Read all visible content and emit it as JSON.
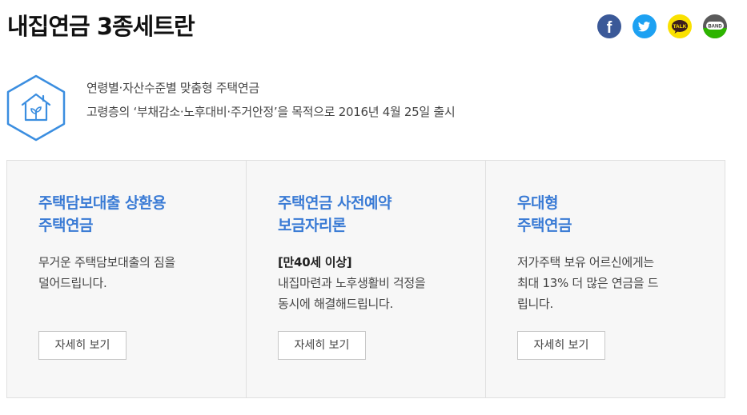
{
  "page": {
    "title": "내집연금 3종세트란"
  },
  "share": {
    "items": [
      {
        "name": "facebook-icon",
        "glyph": "f",
        "color": "#3b5998"
      },
      {
        "name": "twitter-icon",
        "color": "#1da1f2"
      },
      {
        "name": "kakaotalk-icon",
        "glyph": "TALK",
        "color": "#fae100"
      },
      {
        "name": "band-icon",
        "glyph": "BAND",
        "color": "#5a5a5a"
      }
    ]
  },
  "intro": {
    "icon": "house-plant-icon",
    "line1": "연령별·자산수준별 맞춤형 주택연금",
    "line2": "고령층의 ‘부채감소·노후대비·주거안정’을 목적으로 2016년 4월 25일 출시"
  },
  "cards": [
    {
      "title_line1": "주택담보대출 상환용",
      "title_line2": "주택연금",
      "highlight": "",
      "desc_line1": "무거운 주택담보대출의 짐을",
      "desc_line2": "덜어드립니다.",
      "button": "자세히 보기"
    },
    {
      "title_line1": "주택연금 사전예약",
      "title_line2": "보금자리론",
      "highlight": "[만40세 이상]",
      "desc_line1": "내집마련과 노후생활비 걱정을",
      "desc_line2": "동시에 해결해드립니다.",
      "button": "자세히 보기"
    },
    {
      "title_line1": "우대형",
      "title_line2": "주택연금",
      "highlight": "",
      "desc_line1": "저가주택 보유 어르신에게는",
      "desc_line2": "최대 13% 더 많은 연금을 드",
      "desc_line3": "립니다.",
      "button": "자세히 보기"
    }
  ],
  "colors": {
    "accent": "#3a7bd5",
    "icon_blue": "#3b8ee0"
  }
}
